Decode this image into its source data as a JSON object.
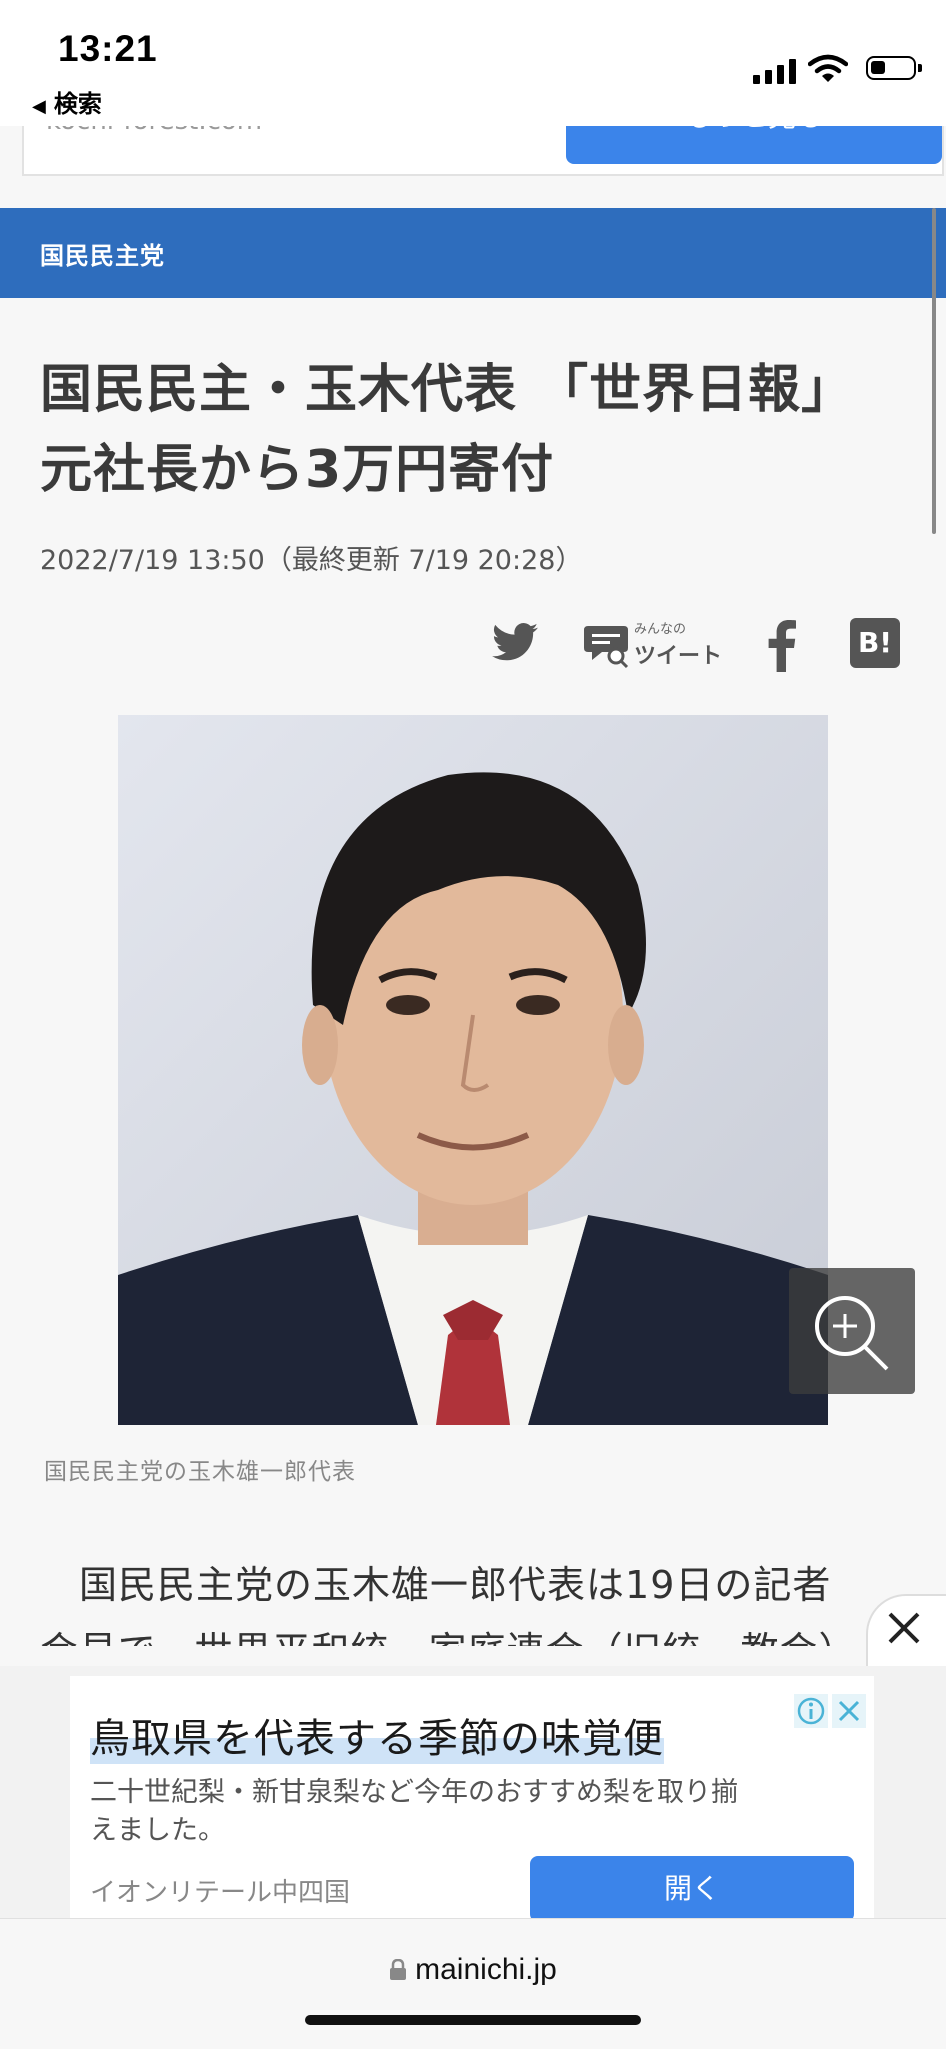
{
  "status_bar": {
    "time": "13:21",
    "back_label": "検索"
  },
  "prev_ad": {
    "url": "kochi-forest.com",
    "more_label": "もっと見る"
  },
  "category": "国民民主党",
  "article": {
    "headline_line1": "国民民主・玉木代表 「世界日報」",
    "headline_line2": "元社長から3万円寄付",
    "date": "2022/7/19 13:50（最終更新 7/19 20:28）",
    "share": {
      "minna_small": "みんなの",
      "minna_main": "ツイート",
      "hatena": "B!"
    },
    "caption": "国民民主党の玉木雄一郎代表",
    "body_line1": "国民民主党の玉木雄一郎代表は19日の記者",
    "body_line2": "会見で、世界平和統一家庭連合（旧統一教会）"
  },
  "ad": {
    "title": "鳥取県を代表する季節の味覚便",
    "desc": "二十世紀梨・新甘泉梨など今年のおすすめ梨を取り揃えました。",
    "sponsor": "イオンリテール中四国",
    "open_label": "開く"
  },
  "browser": {
    "domain": "mainichi.jp"
  },
  "colors": {
    "accent": "#2e6dbd",
    "button": "#3b84ea"
  }
}
